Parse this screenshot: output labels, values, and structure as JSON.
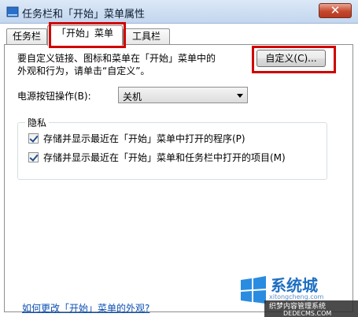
{
  "window": {
    "title": "任务栏和「开始」菜单属性",
    "close_glyph": "✕"
  },
  "tabs": [
    {
      "label": "任务栏"
    },
    {
      "label": "「开始」菜单"
    },
    {
      "label": "工具栏"
    }
  ],
  "start_menu": {
    "description": "要自定义链接、图标和菜单在「开始」菜单中的\n外观和行为，请单击“自定义”。",
    "customize_button": "自定义(C)...",
    "power_label": "电源按钮操作(B):",
    "power_value": "关机",
    "privacy": {
      "title": "隐私",
      "options": [
        {
          "label": "存储并显示最近在「开始」菜单中打开的程序(P)",
          "checked": true
        },
        {
          "label": "存储并显示最近在「开始」菜单和任务栏中打开的项目(M)",
          "checked": true
        }
      ]
    },
    "help_link": "如何更改「开始」菜单的外观?"
  },
  "watermark": {
    "line1": "系统城",
    "line2": "xitongcheng.com",
    "line3": "织梦内容管理系统",
    "line4": "DEDECMS.COM"
  },
  "colors": {
    "highlight": "#d00000",
    "link": "#0a4fb5"
  }
}
